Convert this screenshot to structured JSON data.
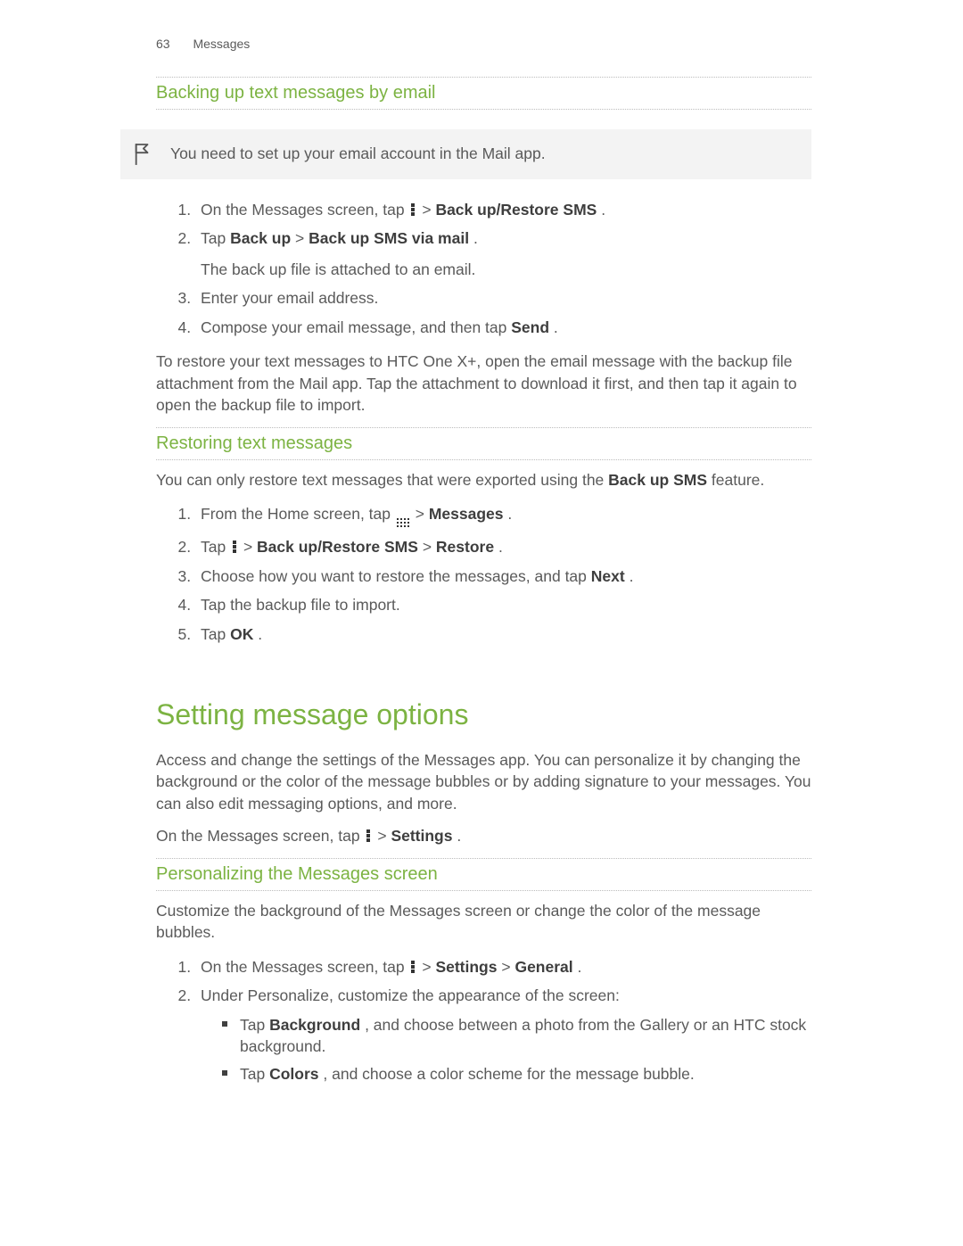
{
  "header": {
    "page_number": "63",
    "section": "Messages"
  },
  "s1": {
    "title": "Backing up text messages by email",
    "note_text": "You need to set up your email account in the Mail app.",
    "step1_a": "On the Messages screen, tap ",
    "step1_b": " > ",
    "step1_c": "Back up/Restore SMS",
    "step1_d": ".",
    "step2_a": "Tap ",
    "step2_b": "Back up",
    "step2_c": " > ",
    "step2_d": "Back up SMS via mail",
    "step2_e": ".",
    "step2_sub": "The back up file is attached to an email.",
    "step3": "Enter your email address.",
    "step4_a": "Compose your email message, and then tap ",
    "step4_b": "Send",
    "step4_c": ".",
    "after": "To restore your text messages to HTC One X+, open the email message with the backup file attachment from the Mail app. Tap the attachment to download it first, and then tap it again to open the backup file to import."
  },
  "s2": {
    "title": "Restoring text messages",
    "intro_a": "You can only restore text messages that were exported using the ",
    "intro_b": "Back up SMS",
    "intro_c": " feature.",
    "step1_a": "From the Home screen, tap ",
    "step1_b": " > ",
    "step1_c": "Messages",
    "step1_d": ".",
    "step2_a": "Tap ",
    "step2_b": " > ",
    "step2_c": "Back up/Restore SMS",
    "step2_d": " > ",
    "step2_e": "Restore",
    "step2_f": ".",
    "step3_a": "Choose how you want to restore the messages, and tap ",
    "step3_b": "Next",
    "step3_c": ".",
    "step4": "Tap the backup file to import.",
    "step5_a": "Tap ",
    "step5_b": "OK",
    "step5_c": "."
  },
  "s3": {
    "title": "Setting message options",
    "intro": "Access and change the settings of the Messages app. You can personalize it by changing the background or the color of the message bubbles or by adding signature to your messages. You can also edit messaging options, and more.",
    "line_a": "On the Messages screen, tap ",
    "line_b": " > ",
    "line_c": "Settings",
    "line_d": "."
  },
  "s4": {
    "title": "Personalizing the Messages screen",
    "intro": "Customize the background of the Messages screen or change the color of the message bubbles.",
    "step1_a": "On the Messages screen, tap ",
    "step1_b": " > ",
    "step1_c": "Settings",
    "step1_d": " > ",
    "step1_e": "General",
    "step1_f": ".",
    "step2": "Under Personalize, customize the appearance of the screen:",
    "b1_a": "Tap ",
    "b1_b": "Background",
    "b1_c": ", and choose between a photo from the Gallery or an HTC stock background.",
    "b2_a": "Tap ",
    "b2_b": "Colors",
    "b2_c": ", and choose a color scheme for the message bubble."
  }
}
